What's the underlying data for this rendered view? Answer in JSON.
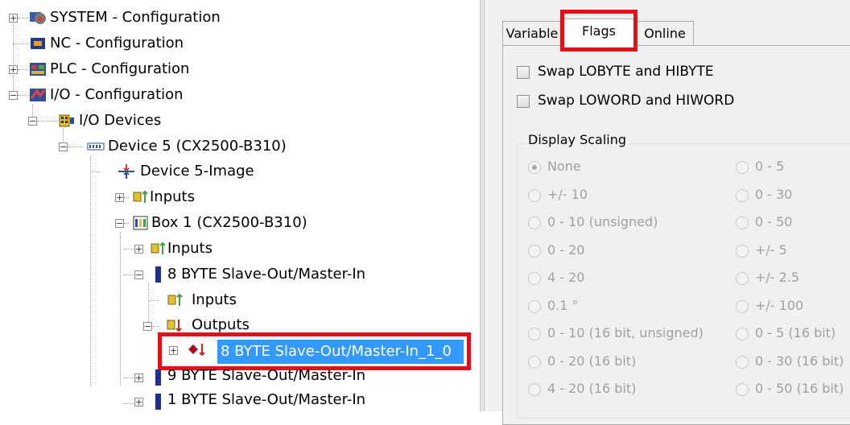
{
  "tree": {
    "system": "SYSTEM - Configuration",
    "nc": "NC - Configuration",
    "plc": "PLC - Configuration",
    "io": "I/O - Configuration",
    "io_devices": "I/O Devices",
    "device5": "Device 5 (CX2500-B310)",
    "device5_image": "Device 5-Image",
    "inputs1": "Inputs",
    "box1": "Box 1 (CX2500-B310)",
    "inputs2": "Inputs",
    "slave8": "8 BYTE Slave-Out/Master-In",
    "inputs3": "Inputs",
    "outputs": "Outputs",
    "selected": "8 BYTE Slave-Out/Master-In_1_0",
    "slave9": "9 BYTE Slave-Out/Master-In",
    "slave1": "1 BYTE Slave-Out/Master-In"
  },
  "tabs": {
    "variable": "Variable",
    "flags": "Flags",
    "online": "Online"
  },
  "flags": {
    "swap_byte": "Swap LOBYTE and HIBYTE",
    "swap_word": "Swap LOWORD and HIWORD"
  },
  "scaling": {
    "title": "Display Scaling",
    "left": [
      "None",
      "+/- 10",
      "0 - 10 (unsigned)",
      "0 - 20",
      "4 - 20",
      "0.1 °",
      "0 - 10 (16 bit, unsigned)",
      "0 - 20 (16 bit)",
      "4 - 20 (16 bit)"
    ],
    "right": [
      "0 - 5",
      "0 - 30",
      "0 - 50",
      "+/- 5",
      "+/- 2.5",
      "+/- 100",
      "0 - 5 (16 bit)",
      "0 - 30 (16 bit)",
      "0 - 50 (16 bit)"
    ],
    "selected": "None"
  },
  "colors": {
    "highlight": "#e3101c",
    "selection": "#3399ff"
  }
}
